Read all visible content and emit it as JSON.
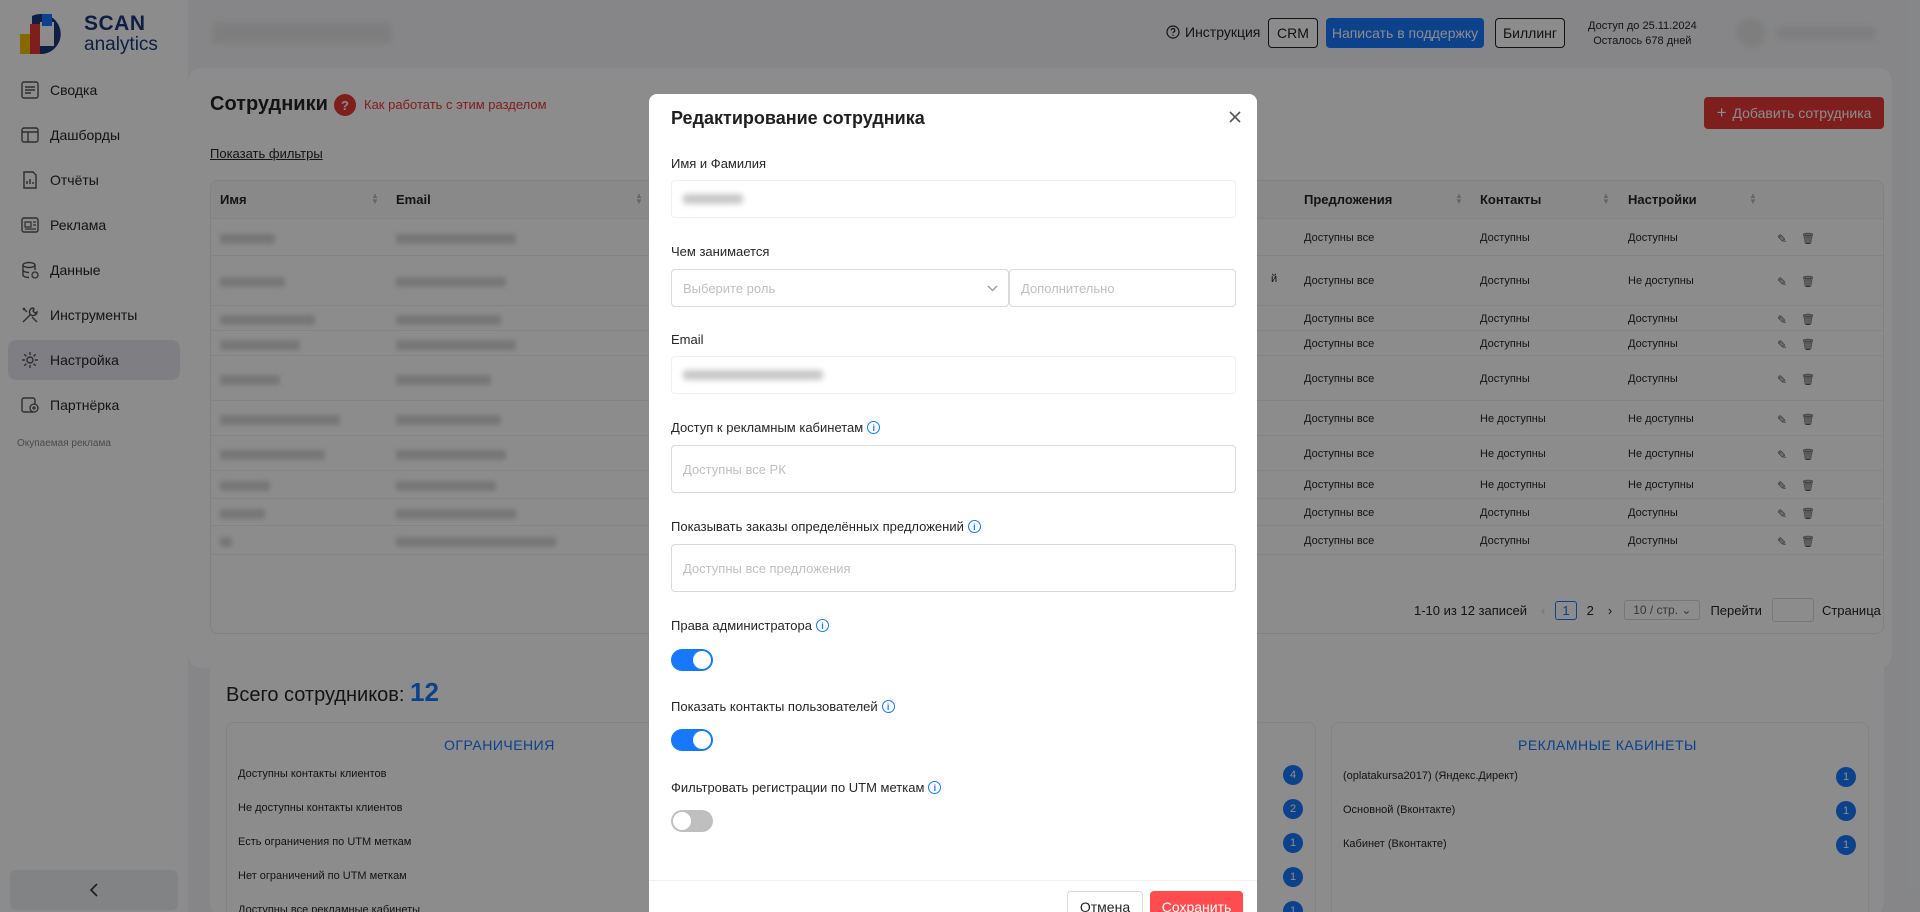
{
  "logo": {
    "line1": "SCAN",
    "line2": "analytics"
  },
  "sidebar": {
    "items": [
      {
        "label": "Сводка",
        "icon": "summary-icon"
      },
      {
        "label": "Дашборды",
        "icon": "dashboard-icon"
      },
      {
        "label": "Отчёты",
        "icon": "reports-icon"
      },
      {
        "label": "Реклама",
        "icon": "ads-icon"
      },
      {
        "label": "Данные",
        "icon": "database-icon"
      },
      {
        "label": "Инструменты",
        "icon": "tools-icon"
      },
      {
        "label": "Настройка",
        "icon": "settings-icon",
        "active": true
      },
      {
        "label": "Партнёрка",
        "icon": "partner-icon"
      }
    ],
    "note": "Окупаемая реклама"
  },
  "topbar": {
    "instruction": "Инструкция",
    "crm": "CRM",
    "support": "Написать в поддержку",
    "billing": "Биллинг",
    "access_until": "Доступ до 25.11.2024",
    "days_left": "Осталось 678 дней"
  },
  "page": {
    "title": "Сотрудники",
    "help_icon": "?",
    "help_link": "Как работать с этим разделом",
    "show_filters": "Показать фильтры",
    "add_button": "Добавить сотрудника"
  },
  "table": {
    "headers": {
      "name": "Имя",
      "email": "Email",
      "offers": "Предложения",
      "contacts": "Контакты",
      "settings": "Настройки"
    },
    "partial_cell": "й",
    "rows": [
      {
        "offers": "Доступны все",
        "contacts": "Доступны",
        "settings": "Доступны"
      },
      {
        "offers": "Доступны все",
        "contacts": "Доступны",
        "settings": "Не доступны"
      },
      {
        "offers": "Доступны все",
        "contacts": "Доступны",
        "settings": "Доступны"
      },
      {
        "offers": "Доступны все",
        "contacts": "Доступны",
        "settings": "Доступны"
      },
      {
        "offers": "Доступны все",
        "contacts": "Доступны",
        "settings": "Доступны"
      },
      {
        "offers": "Доступны все",
        "contacts": "Не доступны",
        "settings": "Не доступны"
      },
      {
        "offers": "Доступны все",
        "contacts": "Не доступны",
        "settings": "Не доступны"
      },
      {
        "offers": "Доступны все",
        "contacts": "Не доступны",
        "settings": "Не доступны"
      },
      {
        "offers": "Доступны все",
        "contacts": "Доступны",
        "settings": "Доступны"
      },
      {
        "offers": "Доступны все",
        "contacts": "Доступны",
        "settings": "Доступны"
      }
    ]
  },
  "pagination": {
    "range": "1-10 из 12 записей",
    "page1": "1",
    "page2": "2",
    "per_page": "10 / стр.",
    "goto": "Перейти",
    "page_word": "Страница"
  },
  "summary": {
    "title": "Всего сотрудников:",
    "count": "12",
    "restrictions": {
      "heading": "ОГРАНИЧЕНИЯ",
      "rows": [
        {
          "label": "Доступны контакты клиентов",
          "count": "4"
        },
        {
          "label": "Не доступны контакты клиентов",
          "count": "2"
        },
        {
          "label": "Есть ограничения по UTM меткам",
          "count": "1"
        },
        {
          "label": "Нет ограничений по UTM меткам",
          "count": "1"
        },
        {
          "label": "Доступны все рекламные кабинеты",
          "count": "1"
        }
      ]
    },
    "cabinets": {
      "heading": "РЕКЛАМНЫЕ КАБИНЕТЫ",
      "rows": [
        {
          "label": "(oplatakursa2017) (Яндекс.Директ)",
          "count": "1"
        },
        {
          "label": "Основной (Вконтакте)",
          "count": "1"
        },
        {
          "label": "Кабинет (Вконтакте)",
          "count": "1"
        }
      ]
    }
  },
  "modal": {
    "title": "Редактирование сотрудника",
    "name_label": "Имя и Фамилия",
    "role_label": "Чем занимается",
    "role_placeholder": "Выберите роль",
    "extra_placeholder": "Дополнительно",
    "email_label": "Email",
    "cabinets_label": "Доступ к рекламным кабинетам",
    "cabinets_placeholder": "Доступны все РК",
    "offers_label": "Показывать заказы определённых предложений",
    "offers_placeholder": "Доступны все предложения",
    "admin_label": "Права администратора",
    "admin_enabled": true,
    "contacts_label": "Показать контакты пользователей",
    "contacts_enabled": true,
    "utm_label": "Фильтровать регистрации по UTM меткам",
    "utm_enabled": false,
    "info_icon": "i",
    "cancel": "Отмена",
    "save": "Сохранить"
  },
  "colors": {
    "accent": "#1677ff",
    "danger": "#e53935",
    "save": "#ff4d4f"
  }
}
